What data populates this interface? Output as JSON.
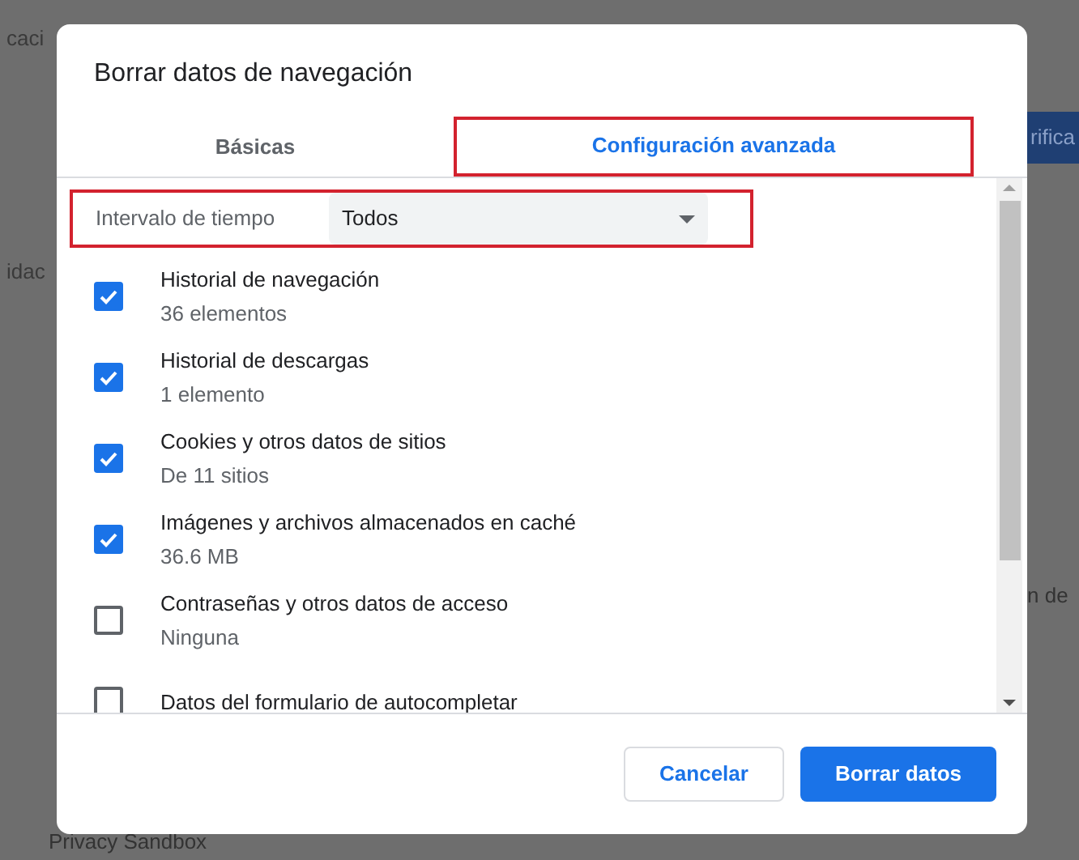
{
  "background": {
    "left_fragments": [
      "caci",
      "idac"
    ],
    "right_fragments": [
      "rifica",
      "n de"
    ],
    "bottom_text": "Privacy Sandbox"
  },
  "dialog": {
    "title": "Borrar datos de navegación",
    "tabs": [
      {
        "label": "Básicas",
        "selected": false,
        "highlighted": false
      },
      {
        "label": "Configuración avanzada",
        "selected": true,
        "highlighted": true
      }
    ],
    "time_range": {
      "label": "Intervalo de tiempo",
      "value": "Todos",
      "highlighted": true
    },
    "items": [
      {
        "title": "Historial de navegación",
        "detail": "36 elementos",
        "checked": true
      },
      {
        "title": "Historial de descargas",
        "detail": "1 elemento",
        "checked": true
      },
      {
        "title": "Cookies y otros datos de sitios",
        "detail": "De 11 sitios",
        "checked": true
      },
      {
        "title": "Imágenes y archivos almacenados en caché",
        "detail": "36.6 MB",
        "checked": true
      },
      {
        "title": "Contraseñas y otros datos de acceso",
        "detail": "Ninguna",
        "checked": false
      },
      {
        "title": "Datos del formulario de autocompletar",
        "checked": false
      }
    ],
    "buttons": [
      {
        "label": "Cancelar",
        "kind": "secondary"
      },
      {
        "label": "Borrar datos",
        "kind": "primary"
      }
    ]
  }
}
